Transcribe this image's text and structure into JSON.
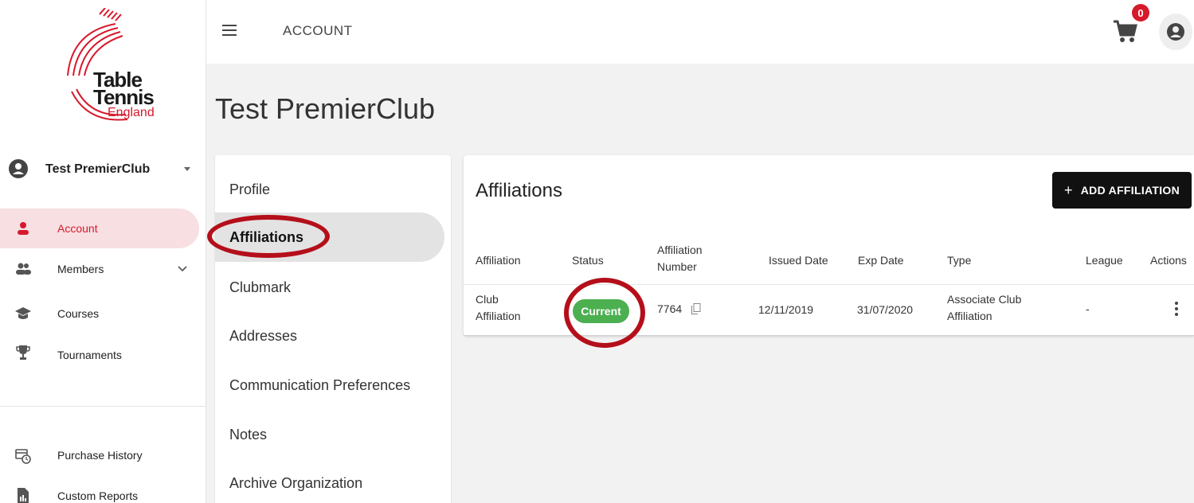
{
  "brand": {
    "logo_alt": "Table Tennis England",
    "logo_line1": "Table",
    "logo_line2": "Tennis",
    "logo_line3": "England"
  },
  "topbar": {
    "title": "ACCOUNT",
    "cart_count": "0",
    "menu_icon": "hamburger-icon",
    "cart_icon": "cart-icon",
    "user_icon": "account-circle-icon"
  },
  "sidebar": {
    "org_name": "Test PremierClub",
    "items": [
      {
        "label": "Account",
        "icon": "person-icon",
        "active": true
      },
      {
        "label": "Members",
        "icon": "people-icon",
        "active": false
      },
      {
        "label": "Courses",
        "icon": "school-icon",
        "active": false
      },
      {
        "label": "Tournaments",
        "icon": "trophy-icon",
        "active": false
      }
    ],
    "bottom_items": [
      {
        "label": "Purchase History",
        "icon": "history-icon"
      },
      {
        "label": "Custom Reports",
        "icon": "report-icon"
      }
    ]
  },
  "page": {
    "title": "Test PremierClub"
  },
  "subnav": {
    "items": [
      {
        "label": "Profile"
      },
      {
        "label": "Affiliations"
      },
      {
        "label": "Clubmark"
      },
      {
        "label": "Addresses"
      },
      {
        "label": "Communication Preferences"
      },
      {
        "label": "Notes"
      },
      {
        "label": "Archive Organization"
      }
    ],
    "active": "Affiliations"
  },
  "affiliations": {
    "title": "Affiliations",
    "add_button": "ADD AFFILIATION",
    "columns": {
      "affiliation": "Affiliation",
      "status": "Status",
      "number_line1": "Affiliation",
      "number_line2": "Number",
      "issued": "Issued Date",
      "exp": "Exp Date",
      "type": "Type",
      "league": "League",
      "actions": "Actions"
    },
    "rows": [
      {
        "affiliation_line1": "Club",
        "affiliation_line2": "Affiliation",
        "status": "Current",
        "number": "7764",
        "issued": "12/11/2019",
        "exp": "31/07/2020",
        "type_line1": "Associate Club",
        "type_line2": "Affiliation",
        "league": "-"
      }
    ]
  },
  "colors": {
    "brand_red": "#d7192c",
    "status_green": "#4caf50",
    "annotation_red": "#b40f1a",
    "active_nav_bg": "#f7dfe2"
  }
}
